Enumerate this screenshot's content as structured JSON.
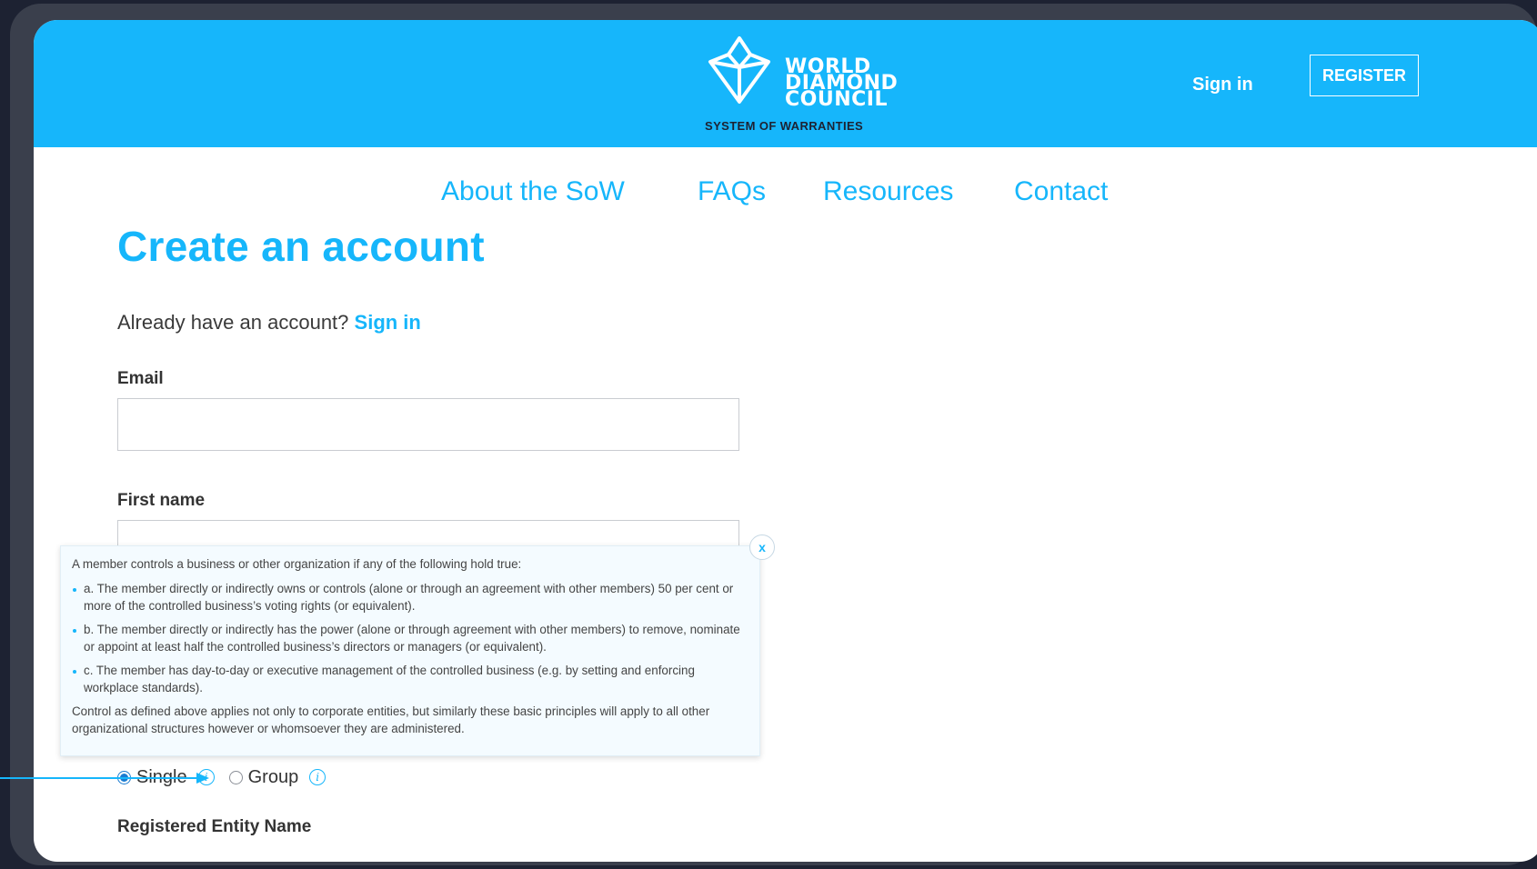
{
  "colors": {
    "accent": "#16b6fb",
    "header_bg": "#16b6fb",
    "frame_bg": "#1d2232",
    "tooltip_bg": "#f4fbff"
  },
  "header": {
    "logo_lines": [
      "WORLD",
      "DIAMOND",
      "COUNCIL"
    ],
    "logo_subtitle": "SYSTEM OF WARRANTIES",
    "signin_label": "Sign in",
    "register_label": "REGISTER"
  },
  "nav": {
    "items": [
      {
        "label": "About the SoW"
      },
      {
        "label": "FAQs"
      },
      {
        "label": "Resources"
      },
      {
        "label": "Contact"
      }
    ]
  },
  "page": {
    "title": "Create an account",
    "already_text": "Already have an account?",
    "signin_link": "Sign in"
  },
  "form": {
    "email_label": "Email",
    "email_value": "",
    "first_name_label": "First name",
    "first_name_value": "",
    "entity_type_options": [
      {
        "label": "Single",
        "selected": true
      },
      {
        "label": "Group",
        "selected": false
      }
    ],
    "registered_entity_label": "Registered Entity Name"
  },
  "tooltip": {
    "intro": "A member controls a business or other organization if any of the following hold true:",
    "items": [
      "a. The member directly or indirectly owns or controls (alone or through an agreement with other members) 50 per cent or more of the controlled business’s voting rights (or equivalent).",
      "b. The member directly or indirectly has the power (alone or through agreement with other members) to remove, nominate or appoint at least half the controlled business’s directors or managers (or equivalent).",
      "c. The member has day-to-day or executive management of the controlled business (e.g. by setting and enforcing workplace standards)."
    ],
    "footer": "Control as defined above applies not only to corporate entities, but similarly these basic principles will apply to all other organizational structures however or whomsoever they are administered.",
    "close_label": "x"
  },
  "icons": {
    "info": "info-icon",
    "close": "close-icon",
    "logo": "diamond-logo-icon",
    "pointer": "pointer-arrow-icon"
  }
}
